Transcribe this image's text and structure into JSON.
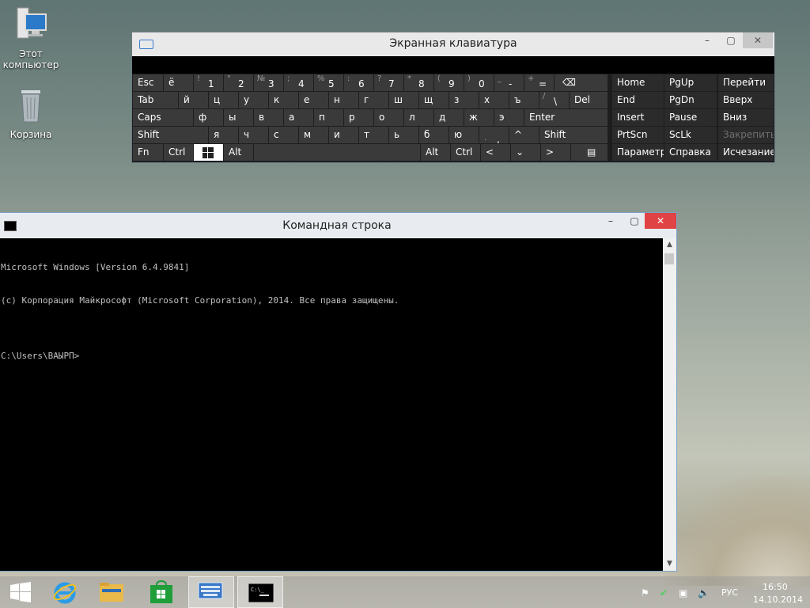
{
  "desktop": {
    "icons": [
      {
        "label_line1": "Этот",
        "label_line2": "компьютер",
        "icon": "computer-icon"
      },
      {
        "label_line1": "Корзина",
        "icon": "recycle-bin-icon"
      }
    ]
  },
  "osk": {
    "title": "Экранная клавиатура",
    "min_label": "–",
    "max_label": "▢",
    "close_label": "✕",
    "row1": [
      {
        "m": "Esc"
      },
      {
        "m": "ё"
      },
      {
        "s": "!",
        "m": "1"
      },
      {
        "s": "\"",
        "m": "2"
      },
      {
        "s": "№",
        "m": "3"
      },
      {
        "s": ";",
        "m": "4"
      },
      {
        "s": "%",
        "m": "5"
      },
      {
        "s": ":",
        "m": "6"
      },
      {
        "s": "?",
        "m": "7"
      },
      {
        "s": "*",
        "m": "8"
      },
      {
        "s": "(",
        "m": "9"
      },
      {
        "s": ")",
        "m": "0"
      },
      {
        "s": "_",
        "m": "-"
      },
      {
        "s": "+",
        "m": "="
      },
      {
        "m": "⌫"
      }
    ],
    "row2": [
      "Tab",
      "й",
      "ц",
      "у",
      "к",
      "е",
      "н",
      "г",
      "ш",
      "щ",
      "з",
      "х",
      "ъ",
      "\\",
      "Del"
    ],
    "row2_shift_slash": "/",
    "row3": [
      "Caps",
      "ф",
      "ы",
      "в",
      "а",
      "п",
      "р",
      "о",
      "л",
      "д",
      "ж",
      "э",
      "Enter"
    ],
    "row4": [
      "Shift",
      "я",
      "ч",
      "с",
      "м",
      "и",
      "т",
      "ь",
      "б",
      "ю",
      ".",
      ",",
      "^",
      "Shift"
    ],
    "row5": [
      "Fn",
      "Ctrl",
      "",
      "Alt",
      "",
      "Alt",
      "Ctrl",
      "<",
      "⌄",
      ">",
      "▤"
    ],
    "right": [
      [
        "Home",
        "PgUp",
        "Перейти"
      ],
      [
        "End",
        "PgDn",
        "Вверх"
      ],
      [
        "Insert",
        "Pause",
        "Вниз"
      ],
      [
        "PrtScn",
        "ScLk",
        "Закрепить"
      ],
      [
        "Параметры",
        "Справка",
        "Исчезание"
      ]
    ]
  },
  "cmd": {
    "title": "Командная строка",
    "lines": [
      "Microsoft Windows [Version 6.4.9841]",
      "(c) Корпорация Майкрософт (Microsoft Corporation), 2014. Все права защищены.",
      "",
      "C:\\Users\\ВАЫРП>"
    ]
  },
  "taskbar": {
    "apps": [
      "start-icon",
      "ie-icon",
      "explorer-icon",
      "store-icon",
      "osk-taskbar-icon",
      "cmd-taskbar-icon"
    ],
    "lang": "РУС",
    "time": "16:50",
    "date": "14.10.2014"
  }
}
